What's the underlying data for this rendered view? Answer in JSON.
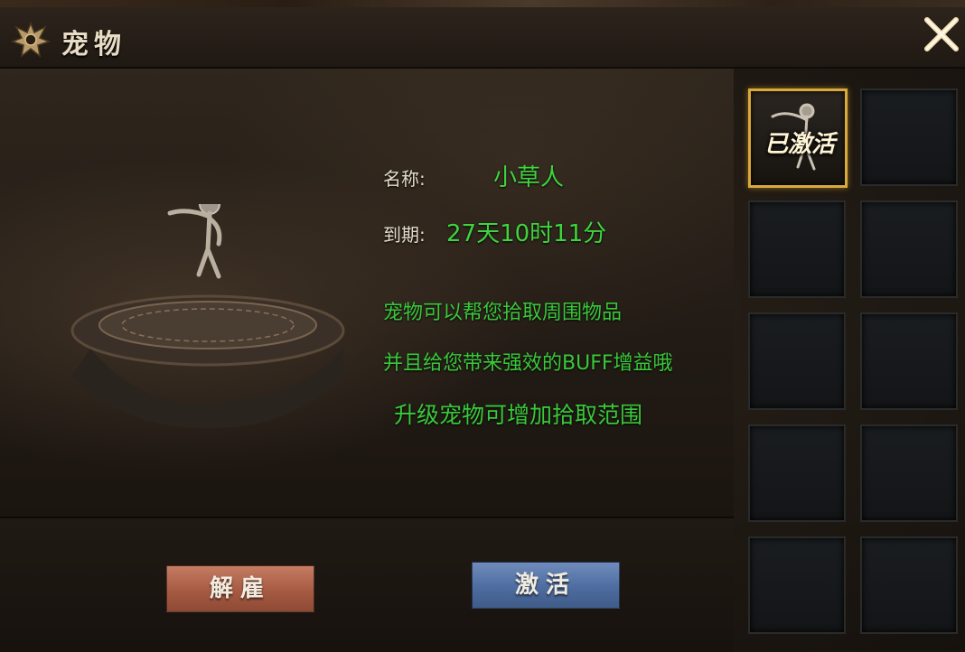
{
  "window": {
    "title": "宠物",
    "close_icon": "close-x-icon",
    "emblem_icon": "winged-crest-icon"
  },
  "pet": {
    "name_label": "名称:",
    "name_value": "小草人",
    "expire_label": "到期:",
    "expire_value": "27天10时11分"
  },
  "description": {
    "line1": "宠物可以帮您拾取周围物品",
    "line2": "并且给您带来强效的BUFF增益哦",
    "line3": "升级宠物可增加拾取范围"
  },
  "buttons": {
    "dismiss_label": "解雇",
    "activate_label": "激活"
  },
  "slots": {
    "active_tag": "已激活",
    "count": 10
  },
  "colors": {
    "value_green": "#3ed43e",
    "active_border": "#d9a93b",
    "dismiss_red": "#a65a42",
    "activate_blue": "#4e6c9f"
  }
}
